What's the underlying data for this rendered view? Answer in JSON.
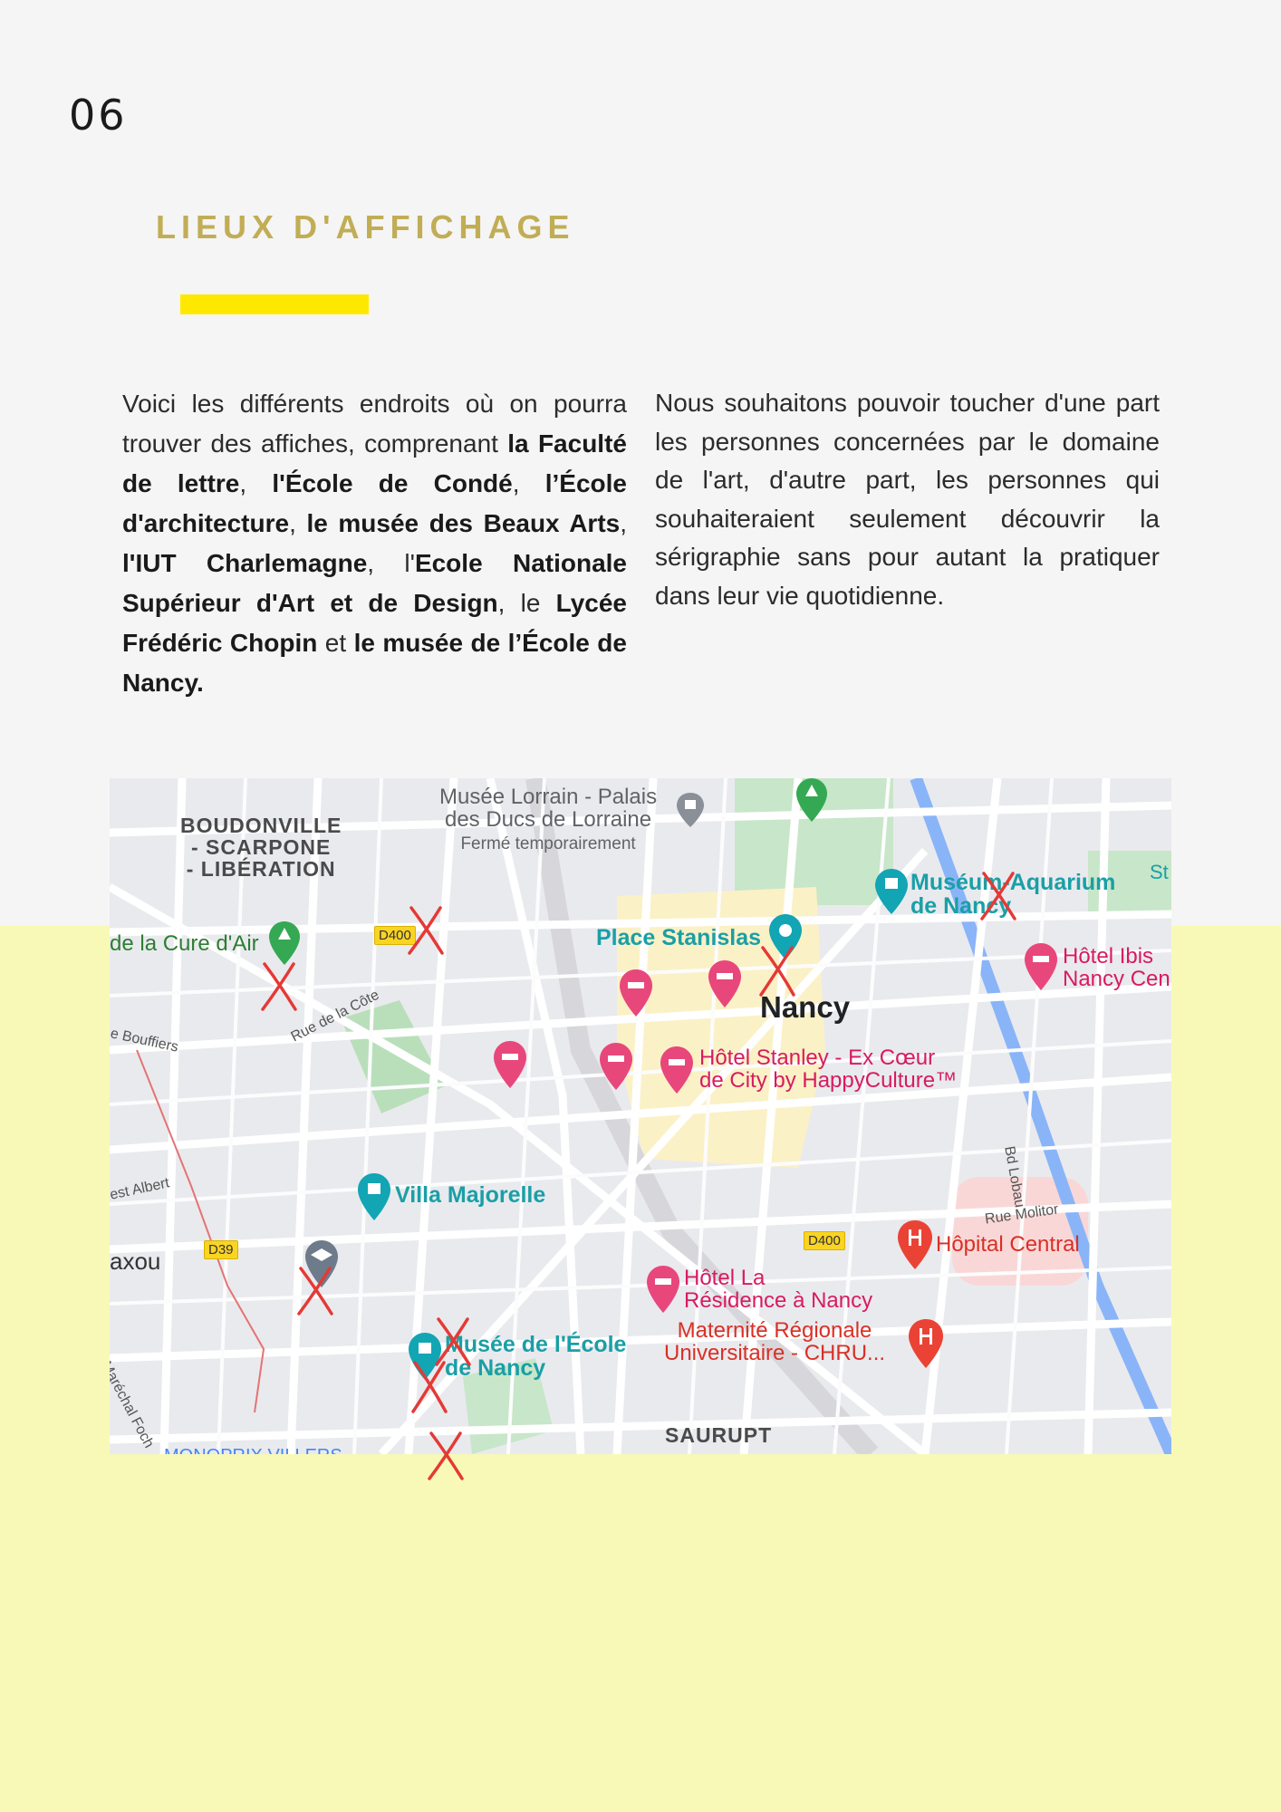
{
  "page": {
    "number": "06",
    "title": "LIEUX D'AFFICHAGE",
    "colors": {
      "title": "#c1ad55",
      "accent_bar": "#ffe800",
      "bottom_band": "#f8f9b6",
      "background": "#f5f5f5"
    }
  },
  "left_column": {
    "segments": [
      {
        "text": "Voici les différents endroits où on pourra trouver des affiches, comprenant ",
        "bold": false
      },
      {
        "text": "la Faculté de lettre",
        "bold": true
      },
      {
        "text": ", ",
        "bold": false
      },
      {
        "text": "l'École de Condé",
        "bold": true
      },
      {
        "text": ", ",
        "bold": false
      },
      {
        "text": "l’École d'architecture",
        "bold": true
      },
      {
        "text": ", ",
        "bold": false
      },
      {
        "text": "le musée des Beaux Arts",
        "bold": true
      },
      {
        "text": ", ",
        "bold": false
      },
      {
        "text": "l'IUT Charlemagne",
        "bold": true
      },
      {
        "text": ", l'",
        "bold": false
      },
      {
        "text": "Ecole Nationale Supérieur d'Art et de Design",
        "bold": true
      },
      {
        "text": ", le ",
        "bold": false
      },
      {
        "text": "Lycée Frédéric Chopin",
        "bold": true
      },
      {
        "text": " et ",
        "bold": false
      },
      {
        "text": "le musée de l’École de Nancy.",
        "bold": true
      }
    ]
  },
  "right_column": {
    "text": "Nous souhaitons pouvoir toucher d'une part les personnes concernées par le domaine de l'art, d'autre part, les personnes qui souhaiteraient seulement découvrir la sérigraphie sans pour autant la pratiquer dans leur vie quotidienne."
  },
  "map": {
    "districts": {
      "boudonville_1": "BOUDONVILLE",
      "boudonville_2": "- SCARPONE",
      "boudonville_3": "- LIBÉRATION",
      "saurupt": "SAURUPT",
      "montbrix": "MONOPRIX VILLERS"
    },
    "places": {
      "musee_lorrain_1": "Musée Lorrain - Palais",
      "musee_lorrain_2": "des Ducs de Lorraine",
      "musee_lorrain_status": "Fermé temporairement",
      "place_stanislas": "Place Stanislas",
      "museum_aquarium_1": "Muséum-Aquarium",
      "museum_aquarium_2": "de Nancy",
      "hotel_ibis_1": "Hôtel Ibis",
      "hotel_ibis_2": "Nancy Cen",
      "city": "Nancy",
      "hotel_stanley_1": "Hôtel Stanley - Ex Cœur",
      "hotel_stanley_2": "de City by HappyCulture™",
      "cure_dair": "de la Cure d'Air",
      "villa_majorelle": "Villa Majorelle",
      "hopital_central": "Hôpital Central",
      "hotel_residence_1": "Hôtel La",
      "hotel_residence_2": "Résidence à Nancy",
      "maternite_1": "Maternité Régionale",
      "maternite_2": "Universitaire -  CHRU...",
      "musee_ecole_1": "Musée de l'École",
      "musee_ecole_2": "de Nancy",
      "maxeville": "axou",
      "st_partial": "St"
    },
    "roads": {
      "rue_de_la_cote": "Rue de la Côte",
      "bouffiers": "e Bouffiers",
      "albert": "est Albert",
      "marechal_foch": "Bd Maréchal Foch",
      "bd_lobau": "Bd Lobau",
      "rue_molitor": "Rue Molitor",
      "d400_a": "D400",
      "d400_b": "D400",
      "d39": "D39"
    },
    "marker_count": 8,
    "marker_color": "#e53935"
  }
}
